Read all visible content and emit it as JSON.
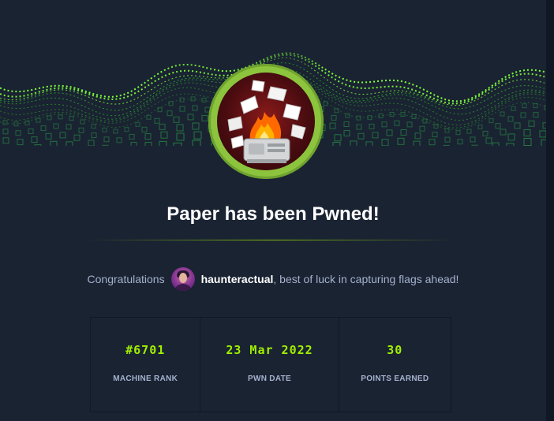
{
  "header": {
    "title": "Paper has been Pwned!"
  },
  "message": {
    "prefix": "Congratulations",
    "username": "haunteractual",
    "suffix": ", best of luck in capturing flags ahead!"
  },
  "stats": [
    {
      "value": "#6701",
      "label": "MACHINE RANK"
    },
    {
      "value": "23 Mar 2022",
      "label": "PWN DATE"
    },
    {
      "value": "30",
      "label": "POINTS EARNED"
    }
  ],
  "colors": {
    "background": "#1a2332",
    "accent": "#9fef00",
    "text_muted": "#a4b1cd",
    "emblem_ring": "#8cc43e"
  },
  "icons": {
    "machine": "burning-printer-icon",
    "user": "user-avatar"
  }
}
